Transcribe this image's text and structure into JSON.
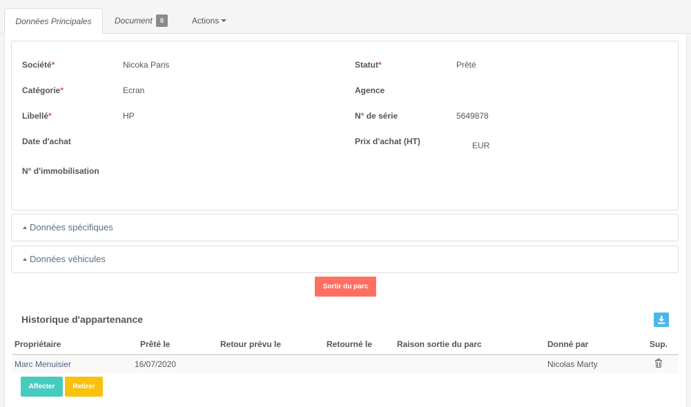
{
  "tabs": {
    "main_label": "Données Principales",
    "document_label": "Document",
    "document_count": "0",
    "actions_label": "Actions"
  },
  "fields": {
    "societe_label": "Société",
    "societe_value": "Nicoka Paris",
    "statut_label": "Statut",
    "statut_value": "Prêté",
    "categorie_label": "Catégorie",
    "categorie_value": "Ecran",
    "agence_label": "Agence",
    "libelle_label": "Libellé",
    "libelle_value": "HP",
    "serie_label": "N° de série",
    "serie_value": "5649878",
    "date_achat_label": "Date d'achat",
    "prix_label": "Prix d'achat (HT)",
    "prix_currency": "EUR",
    "immobilisation_label": "N° d'immobilisation",
    "required_mark": "*"
  },
  "sections": {
    "specifiques": "Données spécifiques",
    "vehicules": "Données véhicules"
  },
  "buttons": {
    "sortir": "Sortir du parc",
    "affecter": "Affecter",
    "retirer": "Retirer"
  },
  "history": {
    "title": "Historique d'appartenance",
    "columns": [
      "Propriétaire",
      "Prêté le",
      "Retour prévu le",
      "Retourné le",
      "Raison sortie du parc",
      "Donné par",
      "Sup."
    ],
    "rows": [
      {
        "proprietaire": "Marc Menuisier",
        "prete_le": "16/07/2020",
        "retour_prevu": "",
        "retourne_le": "",
        "raison": "",
        "donne_par": "Nicolas Marty"
      }
    ]
  },
  "colors": {
    "sortir": "#ff6f62",
    "affecter": "#47cbbf",
    "retirer": "#f9c10d",
    "download": "#4db6e8"
  },
  "icons": {
    "download": "download-icon",
    "trash": "trash-icon"
  }
}
